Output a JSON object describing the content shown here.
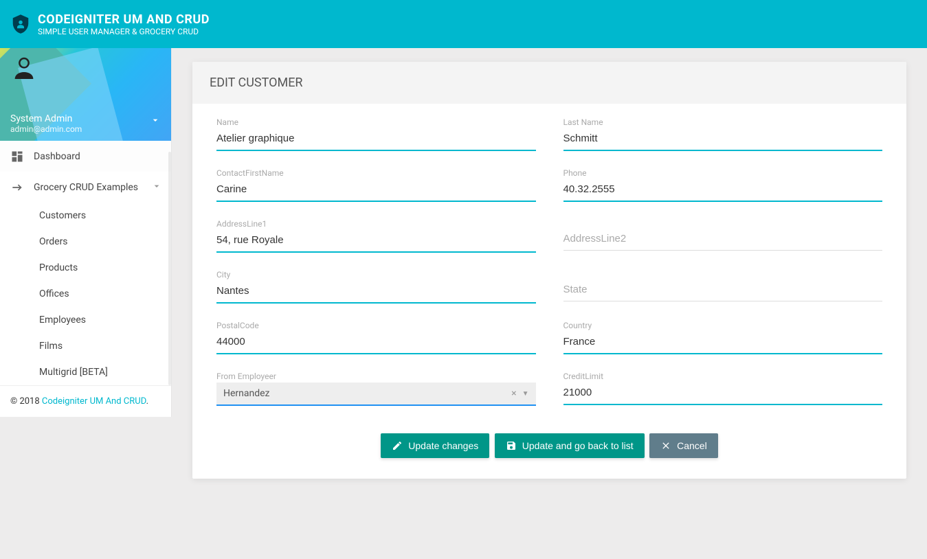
{
  "header": {
    "title": "CODEIGNITER UM AND CRUD",
    "subtitle": "SIMPLE USER MANAGER & GROCERY CRUD"
  },
  "user": {
    "name": "System Admin",
    "email": "admin@admin.com"
  },
  "sidebar": {
    "dashboard": "Dashboard",
    "grocery": "Grocery CRUD Examples",
    "sub": {
      "customers": "Customers",
      "orders": "Orders",
      "products": "Products",
      "offices": "Offices",
      "employees": "Employees",
      "films": "Films",
      "multigrid": "Multigrid [BETA]"
    }
  },
  "footer": {
    "prefix": "© 2018 ",
    "link": "Codeigniter UM And CRUD",
    "suffix": "."
  },
  "card": {
    "title": "EDIT CUSTOMER"
  },
  "form": {
    "name": {
      "label": "Name",
      "value": "Atelier graphique"
    },
    "lastname": {
      "label": "Last Name",
      "value": "Schmitt"
    },
    "contactfirst": {
      "label": "ContactFirstName",
      "value": "Carine"
    },
    "phone": {
      "label": "Phone",
      "value": "40.32.2555"
    },
    "address1": {
      "label": "AddressLine1",
      "value": "54, rue Royale"
    },
    "address2": {
      "placeholder": "AddressLine2",
      "value": ""
    },
    "city": {
      "label": "City",
      "value": "Nantes"
    },
    "state": {
      "placeholder": "State",
      "value": ""
    },
    "postal": {
      "label": "PostalCode",
      "value": "44000"
    },
    "country": {
      "label": "Country",
      "value": "France"
    },
    "employer": {
      "label": "From Employeer",
      "value": "Hernandez"
    },
    "credit": {
      "label": "CreditLimit",
      "value": "21000"
    }
  },
  "buttons": {
    "update": "Update changes",
    "update_back": "Update and go back to list",
    "cancel": "Cancel"
  }
}
